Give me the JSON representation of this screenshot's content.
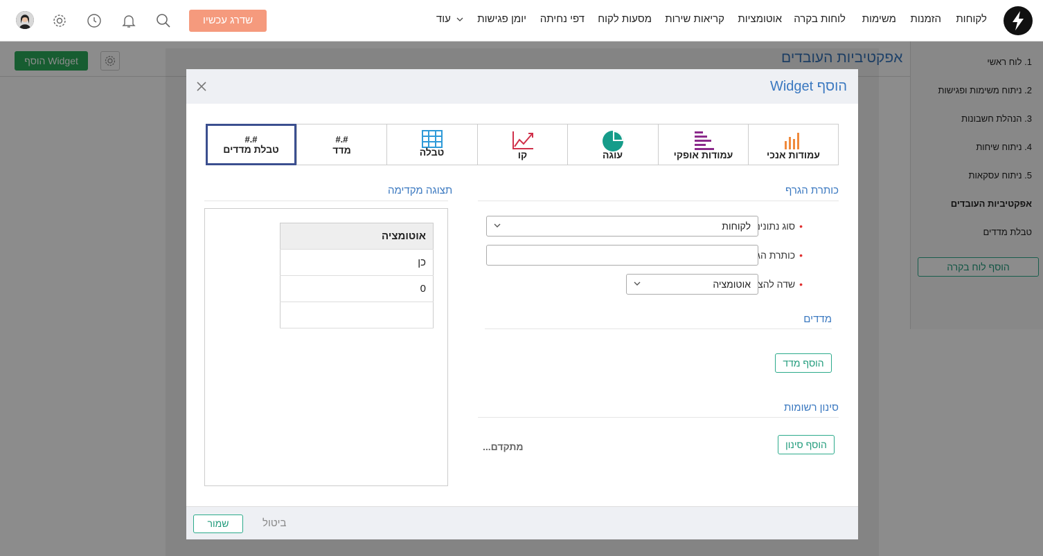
{
  "topbar": {
    "nav": [
      "לקוחות",
      "הזמנות",
      "משימות",
      "לוחות בקרה",
      "אוטומציות",
      "קריאות שירות",
      "מסעות לקוח",
      "דפי נחיתה",
      "יומן פגישות",
      "עוד"
    ],
    "upgrade_label": "שדרג עכשיו"
  },
  "page": {
    "title": "אפקטיביות העובדים",
    "add_widget_label": "הוסף Widget"
  },
  "sidebar": {
    "items": [
      "1. לוח ראשי",
      "2. ניתוח משימות ופגישות",
      "3. הנהלת חשבונות",
      "4. ניתוח שיחות",
      "5. ניתוח עסקאות",
      "אפקטיביות העובדים",
      "טבלת מדדים"
    ],
    "add_dashboard_label": "הוסף לוח בקרה"
  },
  "modal": {
    "title": "הוסף Widget",
    "types": [
      {
        "label": "עמודות אנכי",
        "icon": "vertical-bars-icon"
      },
      {
        "label": "עמודות אופקי",
        "icon": "horizontal-bars-icon"
      },
      {
        "label": "עוגה",
        "icon": "pie-icon"
      },
      {
        "label": "קו",
        "icon": "line-chart-icon"
      },
      {
        "label": "טבלה",
        "icon": "table-icon"
      },
      {
        "label": "מדד",
        "icon": "#.#"
      },
      {
        "label": "טבלת מדדים",
        "icon": "#.#"
      }
    ],
    "selected_type": "טבלת מדדים",
    "chart_title_section": "כותרת הגרף",
    "data_type_label": "סוג נתונים",
    "data_type_value": "לקוחות",
    "chart_title_label": "כותרת הגרף",
    "chart_title_value": "",
    "display_field_label": "שדה להצגה",
    "display_field_value": "אוטומציה",
    "metrics_section": "מדדים",
    "add_metric_label": "הוסף מדד",
    "filter_section": "סינון רשומות",
    "add_filter_label": "הוסף סינון",
    "advanced_label": "מתקדם...",
    "preview_section": "תצוגה מקדימה",
    "preview_table": {
      "header": "אוטומציה",
      "rows": [
        "כן",
        "0",
        ""
      ]
    },
    "save_label": "שמור",
    "cancel_label": "ביטול"
  },
  "colors": {
    "accent_blue": "#3a78c0",
    "upgrade_orange": "#f59a7d",
    "green": "#2aaa8a",
    "selected_border": "#3b4f8f"
  }
}
